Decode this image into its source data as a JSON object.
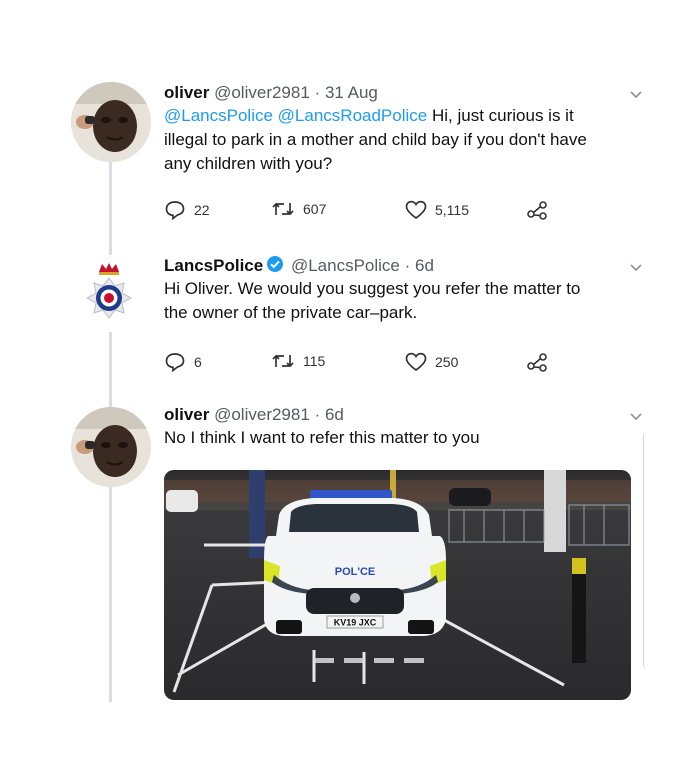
{
  "tweets": [
    {
      "name": "oliver",
      "handle": "@oliver2981",
      "separator": "·",
      "date": "31 Aug",
      "mentions": [
        "@LancsPolice",
        "@LancsRoadPolice"
      ],
      "text_line1": "Hi, just curious is it",
      "text_line2": "illegal to park in a mother and child bay if you don't have",
      "text_line3": "any children with you?",
      "replies": "22",
      "retweets": "607",
      "likes": "5,115"
    },
    {
      "name": "LancsPolice",
      "handle": "@LancsPolice",
      "separator": "·",
      "date": "6d",
      "text_line1": "Hi Oliver. We would you suggest you refer the matter to",
      "text_line2": "the owner of the private car–park.",
      "replies": "6",
      "retweets": "115",
      "likes": "250"
    },
    {
      "name": "oliver",
      "handle": "@oliver2981",
      "separator": "·",
      "date": "6d",
      "text_line1": "No I think I want to refer this matter to you",
      "photo": {
        "police_text": "POL'CE",
        "plate": "KV19 JXC"
      }
    }
  ],
  "colors": {
    "mention": "#1d9bf0",
    "verified": "#1d9bf0",
    "thread_line": "#d7dde2"
  }
}
